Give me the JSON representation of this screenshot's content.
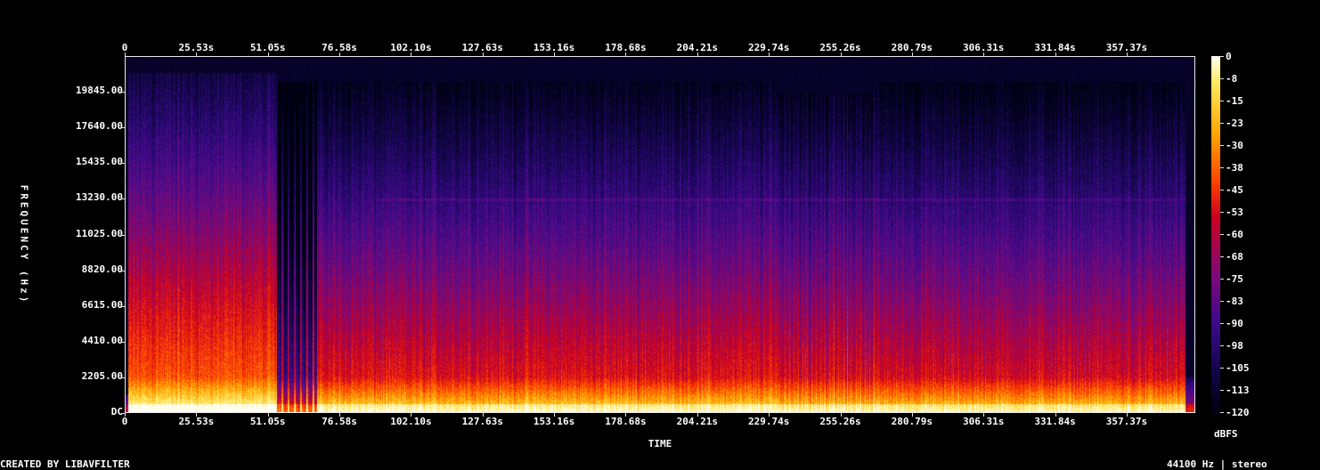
{
  "chart_data": {
    "type": "heatmap",
    "title": "",
    "xlabel": "TIME",
    "ylabel": "FREQUENCY (Hz)",
    "x_ticks": [
      "0",
      "25.53s",
      "51.05s",
      "76.58s",
      "102.10s",
      "127.63s",
      "153.16s",
      "178.68s",
      "204.21s",
      "229.74s",
      "255.26s",
      "280.79s",
      "306.31s",
      "331.84s",
      "357.37s"
    ],
    "x_range": [
      0,
      383.0
    ],
    "y_ticks": [
      "DC",
      "2205.00",
      "4410.00",
      "6615.00",
      "8820.00",
      "11025.00",
      "13230.00",
      "15435.00",
      "17640.00",
      "19845.00"
    ],
    "y_range": [
      0,
      22050
    ],
    "colorbar_label": "dBFS",
    "colorbar_ticks": [
      "0",
      "-8",
      "-15",
      "-23",
      "-30",
      "-38",
      "-45",
      "-53",
      "-60",
      "-68",
      "-75",
      "-83",
      "-90",
      "-98",
      "-105",
      "-113",
      "-120"
    ],
    "colorbar_range": [
      -120,
      0
    ],
    "colormap": [
      "#000010",
      "#12064a",
      "#3c0a8c",
      "#7a0a7a",
      "#cc0020",
      "#ff4400",
      "#ffa500",
      "#ffe65a",
      "#fffff4"
    ]
  },
  "footer": {
    "credit": "CREATED BY LIBAVFILTER",
    "info": "44100 Hz | stereo"
  }
}
